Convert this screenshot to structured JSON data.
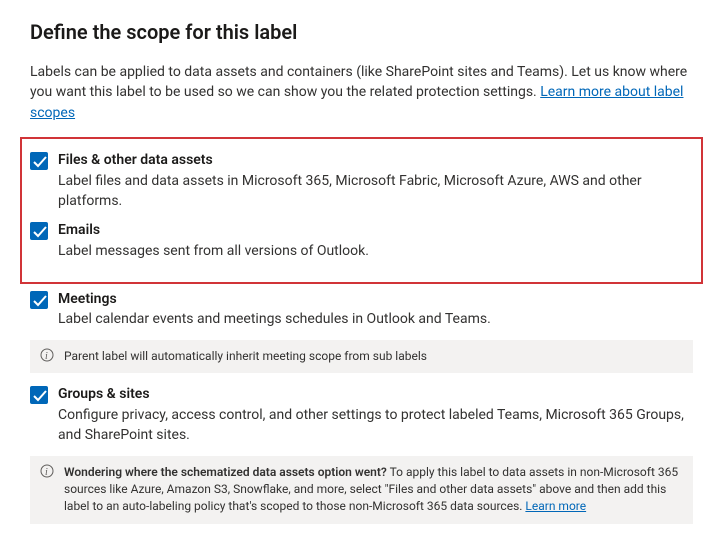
{
  "title": "Define the scope for this label",
  "intro": "Labels can be applied to data assets and containers (like SharePoint sites and Teams). Let us know where you want this label to be used so we can show you the related protection settings. ",
  "intro_link": "Learn more about label scopes",
  "scopes": [
    {
      "label": "Files & other data assets",
      "desc": "Label files and data assets in Microsoft 365, Microsoft Fabric, Microsoft Azure, AWS and other platforms."
    },
    {
      "label": "Emails",
      "desc": "Label messages sent from all versions of Outlook."
    },
    {
      "label": "Meetings",
      "desc": "Label calendar events and meetings schedules in Outlook and Teams."
    },
    {
      "label": "Groups & sites",
      "desc": "Configure privacy, access control, and other settings to protect labeled Teams, Microsoft 365 Groups, and SharePoint sites."
    }
  ],
  "info_meetings": "Parent label will automatically inherit meeting scope from sub labels",
  "info_schema_lead": "Wondering where the schematized data assets option went?",
  "info_schema_body": " To apply this label to data assets in non-Microsoft 365 sources like Azure, Amazon S3, Snowflake, and more, select \"Files and other data assets\" above and then add this label to an auto-labeling policy that's scoped to those non-Microsoft 365 data sources. ",
  "info_schema_link": "Learn more"
}
